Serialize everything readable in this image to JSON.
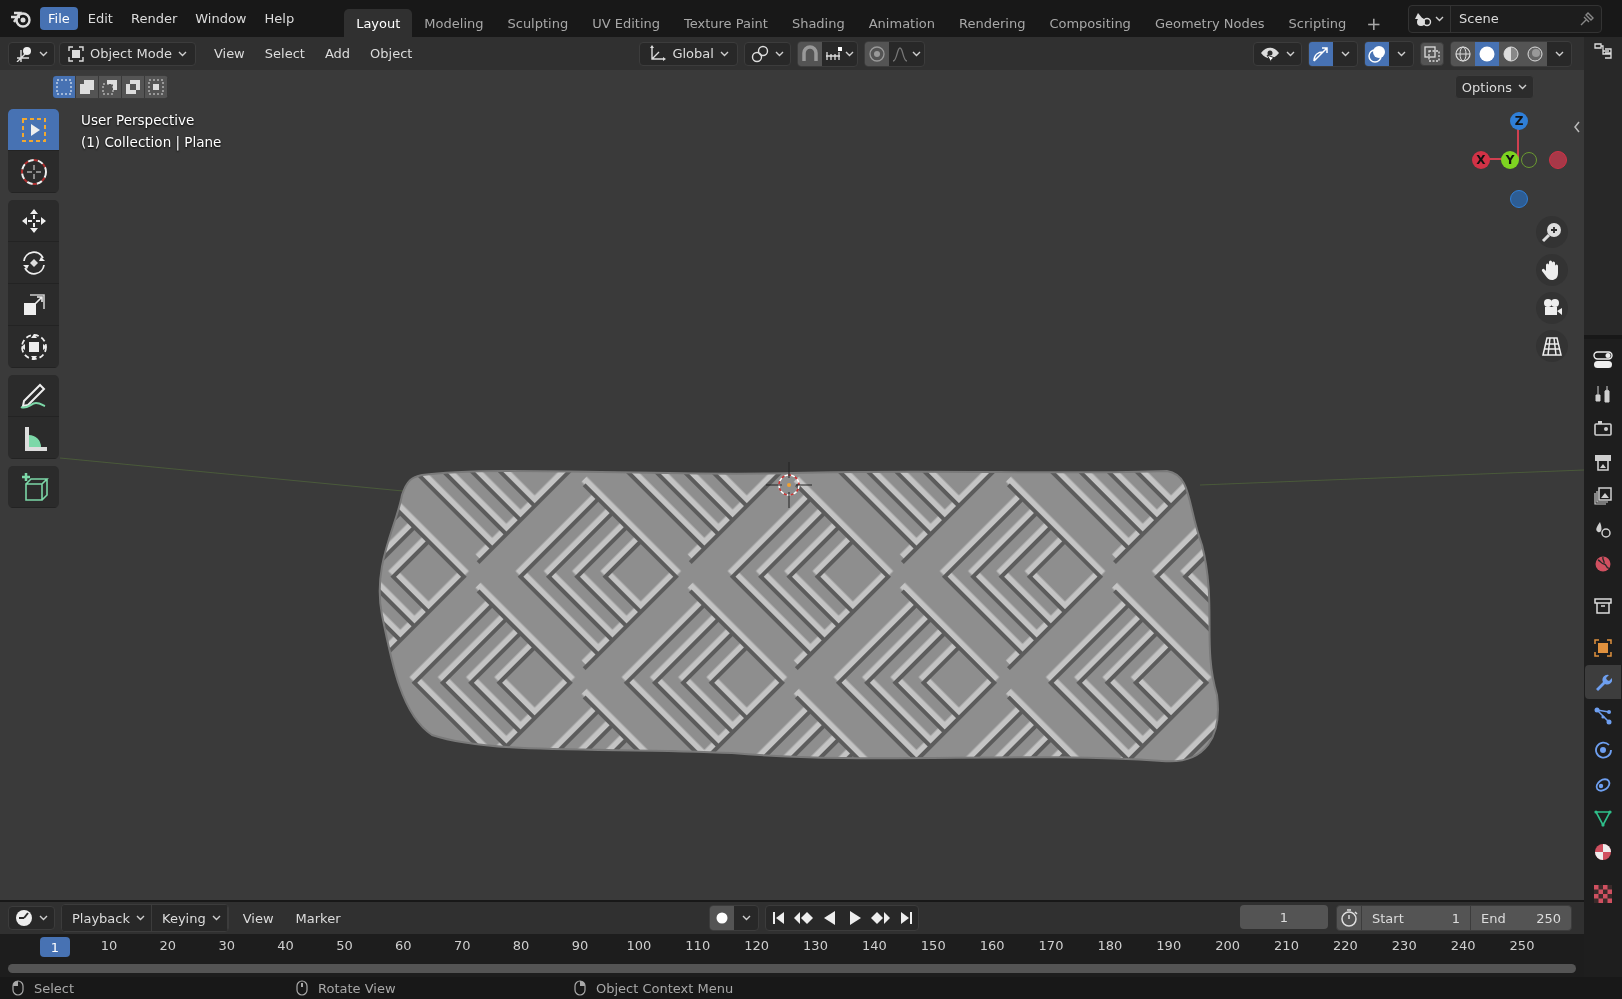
{
  "top_bar": {
    "menus": [
      {
        "label": "File",
        "selected": true
      },
      {
        "label": "Edit",
        "selected": false
      },
      {
        "label": "Render",
        "selected": false
      },
      {
        "label": "Window",
        "selected": false
      },
      {
        "label": "Help",
        "selected": false
      }
    ],
    "workspaces": [
      {
        "label": "Layout",
        "selected": true
      },
      {
        "label": "Modeling",
        "selected": false
      },
      {
        "label": "Sculpting",
        "selected": false
      },
      {
        "label": "UV Editing",
        "selected": false
      },
      {
        "label": "Texture Paint",
        "selected": false
      },
      {
        "label": "Shading",
        "selected": false
      },
      {
        "label": "Animation",
        "selected": false
      },
      {
        "label": "Rendering",
        "selected": false
      },
      {
        "label": "Compositing",
        "selected": false
      },
      {
        "label": "Geometry Nodes",
        "selected": false
      },
      {
        "label": "Scripting",
        "selected": false
      }
    ],
    "add_workspace": "+",
    "scene": "Scene"
  },
  "viewport_header": {
    "mode": "Object Mode",
    "menus": [
      "View",
      "Select",
      "Add",
      "Object"
    ],
    "orientation": "Global",
    "snap_on": false,
    "proportional_on": false,
    "gizmos_on": true,
    "overlays_on": true,
    "xray_on": false,
    "shading": [
      {
        "kind": "wireframe",
        "selected": false
      },
      {
        "kind": "solid",
        "selected": true
      },
      {
        "kind": "material",
        "selected": false
      },
      {
        "kind": "rendered",
        "selected": false
      }
    ],
    "select_modes": [
      {
        "kind": "new",
        "selected": true
      },
      {
        "kind": "extend",
        "selected": false
      },
      {
        "kind": "subtract",
        "selected": false
      },
      {
        "kind": "invert",
        "selected": false
      },
      {
        "kind": "intersect",
        "selected": false
      }
    ],
    "options": "Options"
  },
  "viewport": {
    "view_name": "User Perspective",
    "object_info": "(1) Collection | Plane",
    "tool_groups": [
      {
        "tools": [
          {
            "kind": "select",
            "selected": true
          },
          {
            "kind": "cursor",
            "selected": false
          }
        ]
      },
      {
        "tools": [
          {
            "kind": "move",
            "selected": false
          },
          {
            "kind": "rotate",
            "selected": false
          },
          {
            "kind": "scale",
            "selected": false
          },
          {
            "kind": "transform",
            "selected": false
          }
        ]
      },
      {
        "tools": [
          {
            "kind": "annotate",
            "selected": false
          },
          {
            "kind": "measure",
            "selected": false
          }
        ]
      },
      {
        "tools": [
          {
            "kind": "add_cube",
            "selected": false
          }
        ]
      }
    ],
    "axis_labels": [
      "X",
      "Y",
      "Z"
    ]
  },
  "properties_tabs": [
    {
      "kind": "tool",
      "selected": false
    },
    {
      "kind": "render",
      "selected": false
    },
    {
      "kind": "output",
      "selected": false
    },
    {
      "kind": "view_layer",
      "selected": false
    },
    {
      "kind": "scene",
      "selected": false
    },
    {
      "kind": "world",
      "selected": false
    },
    {
      "kind": "collection",
      "selected": false
    },
    {
      "kind": "object",
      "selected": false
    },
    {
      "kind": "modifiers",
      "selected": true
    },
    {
      "kind": "particles",
      "selected": false
    },
    {
      "kind": "physics",
      "selected": false
    },
    {
      "kind": "constraints",
      "selected": false
    },
    {
      "kind": "data",
      "selected": false
    },
    {
      "kind": "material",
      "selected": false
    },
    {
      "kind": "texture",
      "selected": false
    }
  ],
  "timeline": {
    "menus": [
      {
        "label": "Playback",
        "dropdown": true
      },
      {
        "label": "Keying",
        "dropdown": true
      },
      {
        "label": "View",
        "dropdown": false
      },
      {
        "label": "Marker",
        "dropdown": false
      }
    ],
    "current_frame": "1",
    "start_label": "Start",
    "start": "1",
    "end_label": "End",
    "end": "250",
    "playhead": "1",
    "ruler_labels": [
      "10",
      "20",
      "30",
      "40",
      "50",
      "60",
      "70",
      "80",
      "90",
      "100",
      "110",
      "120",
      "130",
      "140",
      "150",
      "160",
      "170",
      "180",
      "190",
      "200",
      "210",
      "220",
      "230",
      "240",
      "250"
    ]
  },
  "status_bar": [
    {
      "kind": "left",
      "label": "Select"
    },
    {
      "kind": "middle",
      "label": "Rotate View"
    },
    {
      "kind": "right",
      "label": "Object Context Menu"
    }
  ]
}
